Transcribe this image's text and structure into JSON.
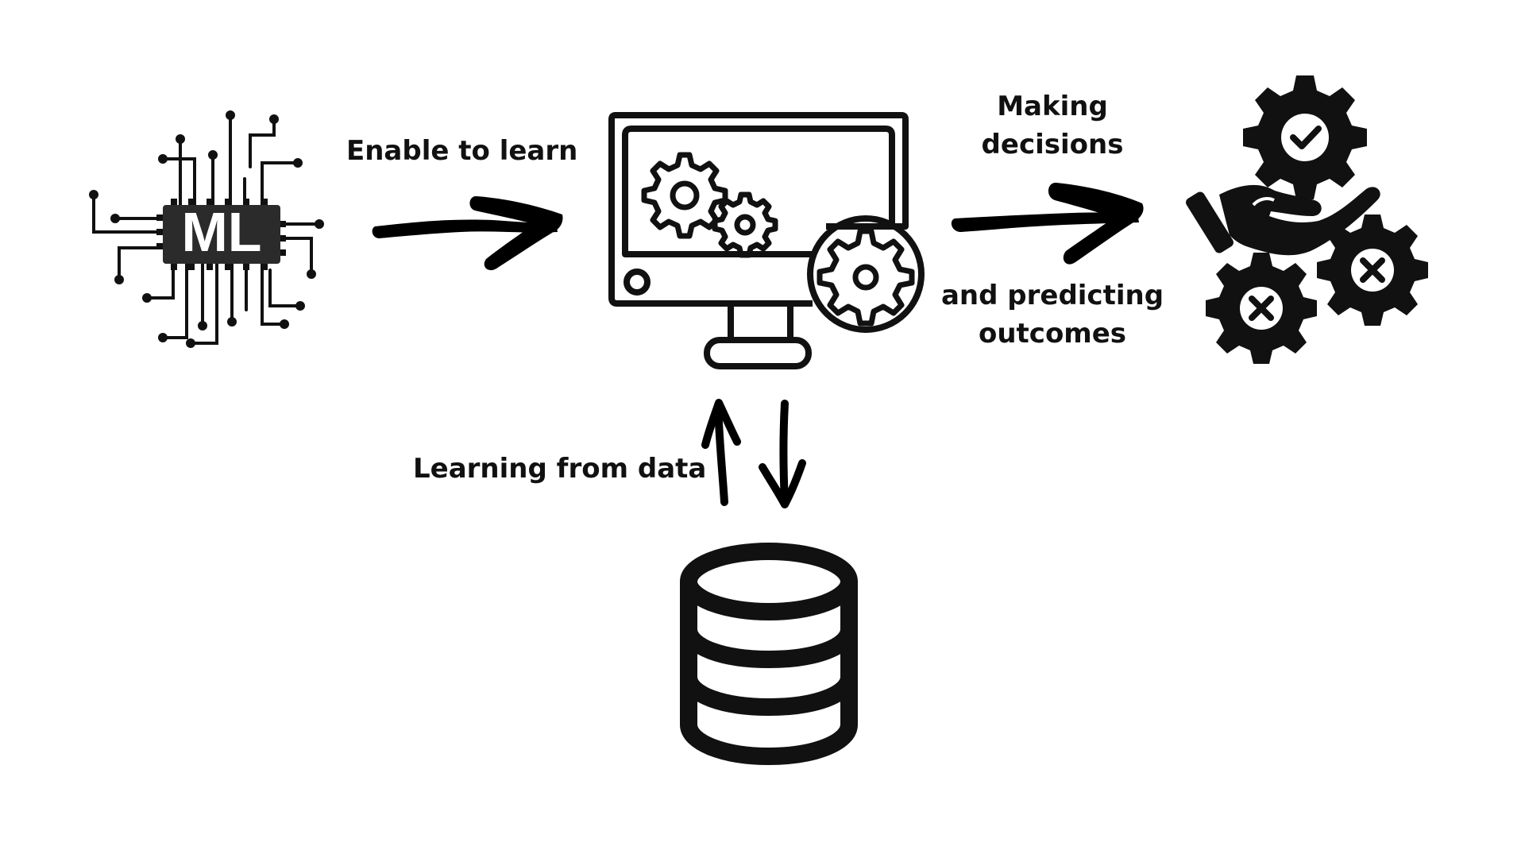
{
  "chip": {
    "text": "ML"
  },
  "labels": {
    "enable": "Enable to learn",
    "making_line1": "Making",
    "making_line2": "decisions",
    "predicting_line1": "and predicting",
    "predicting_line2": "outcomes",
    "learning": "Learning from data"
  },
  "colors": {
    "ink": "#111111",
    "chip_fill": "#2b2b2b",
    "background": "#ffffff"
  },
  "icons": [
    "ml-chip-icon",
    "computer-settings-icon",
    "database-icon",
    "hand-gears-icon"
  ]
}
